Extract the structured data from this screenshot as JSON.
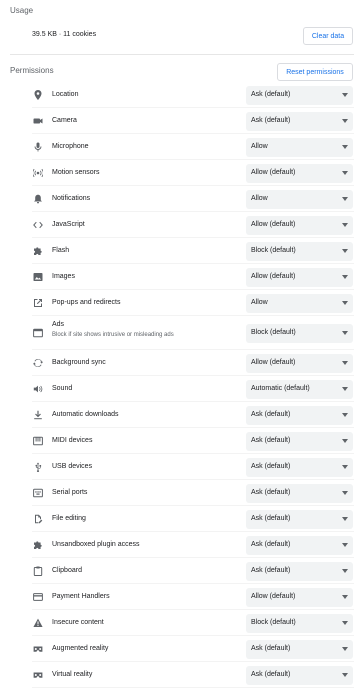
{
  "usage": {
    "title": "Usage",
    "summary": "39.5 KB · 11 cookies",
    "clear_label": "Clear data"
  },
  "permissions": {
    "title": "Permissions",
    "reset_label": "Reset permissions",
    "items": [
      {
        "label": "Location",
        "value": "Ask (default)",
        "icon": "location-icon"
      },
      {
        "label": "Camera",
        "value": "Ask (default)",
        "icon": "camera-icon"
      },
      {
        "label": "Microphone",
        "value": "Allow",
        "icon": "microphone-icon"
      },
      {
        "label": "Motion sensors",
        "value": "Allow (default)",
        "icon": "motion-sensors-icon"
      },
      {
        "label": "Notifications",
        "value": "Allow",
        "icon": "bell-icon"
      },
      {
        "label": "JavaScript",
        "value": "Allow (default)",
        "icon": "code-icon"
      },
      {
        "label": "Flash",
        "value": "Block (default)",
        "icon": "puzzle-icon"
      },
      {
        "label": "Images",
        "value": "Allow (default)",
        "icon": "image-icon"
      },
      {
        "label": "Pop-ups and redirects",
        "value": "Allow",
        "icon": "open-in-new-icon"
      },
      {
        "label": "Ads",
        "sublabel": "Block if site shows intrusive or misleading ads",
        "value": "Block (default)",
        "icon": "ads-icon"
      },
      {
        "label": "Background sync",
        "value": "Allow (default)",
        "icon": "sync-icon"
      },
      {
        "label": "Sound",
        "value": "Automatic (default)",
        "icon": "speaker-icon"
      },
      {
        "label": "Automatic downloads",
        "value": "Ask (default)",
        "icon": "download-icon"
      },
      {
        "label": "MIDI devices",
        "value": "Ask (default)",
        "icon": "midi-icon"
      },
      {
        "label": "USB devices",
        "value": "Ask (default)",
        "icon": "usb-icon"
      },
      {
        "label": "Serial ports",
        "value": "Ask (default)",
        "icon": "serial-port-icon"
      },
      {
        "label": "File editing",
        "value": "Ask (default)",
        "icon": "file-edit-icon"
      },
      {
        "label": "Unsandboxed plugin access",
        "value": "Ask (default)",
        "icon": "puzzle-icon"
      },
      {
        "label": "Clipboard",
        "value": "Ask (default)",
        "icon": "clipboard-icon"
      },
      {
        "label": "Payment Handlers",
        "value": "Allow (default)",
        "icon": "credit-card-icon"
      },
      {
        "label": "Insecure content",
        "value": "Block (default)",
        "icon": "warning-icon"
      },
      {
        "label": "Augmented reality",
        "value": "Ask (default)",
        "icon": "vr-headset-icon"
      },
      {
        "label": "Virtual reality",
        "value": "Ask (default)",
        "icon": "vr-headset-icon"
      }
    ]
  }
}
